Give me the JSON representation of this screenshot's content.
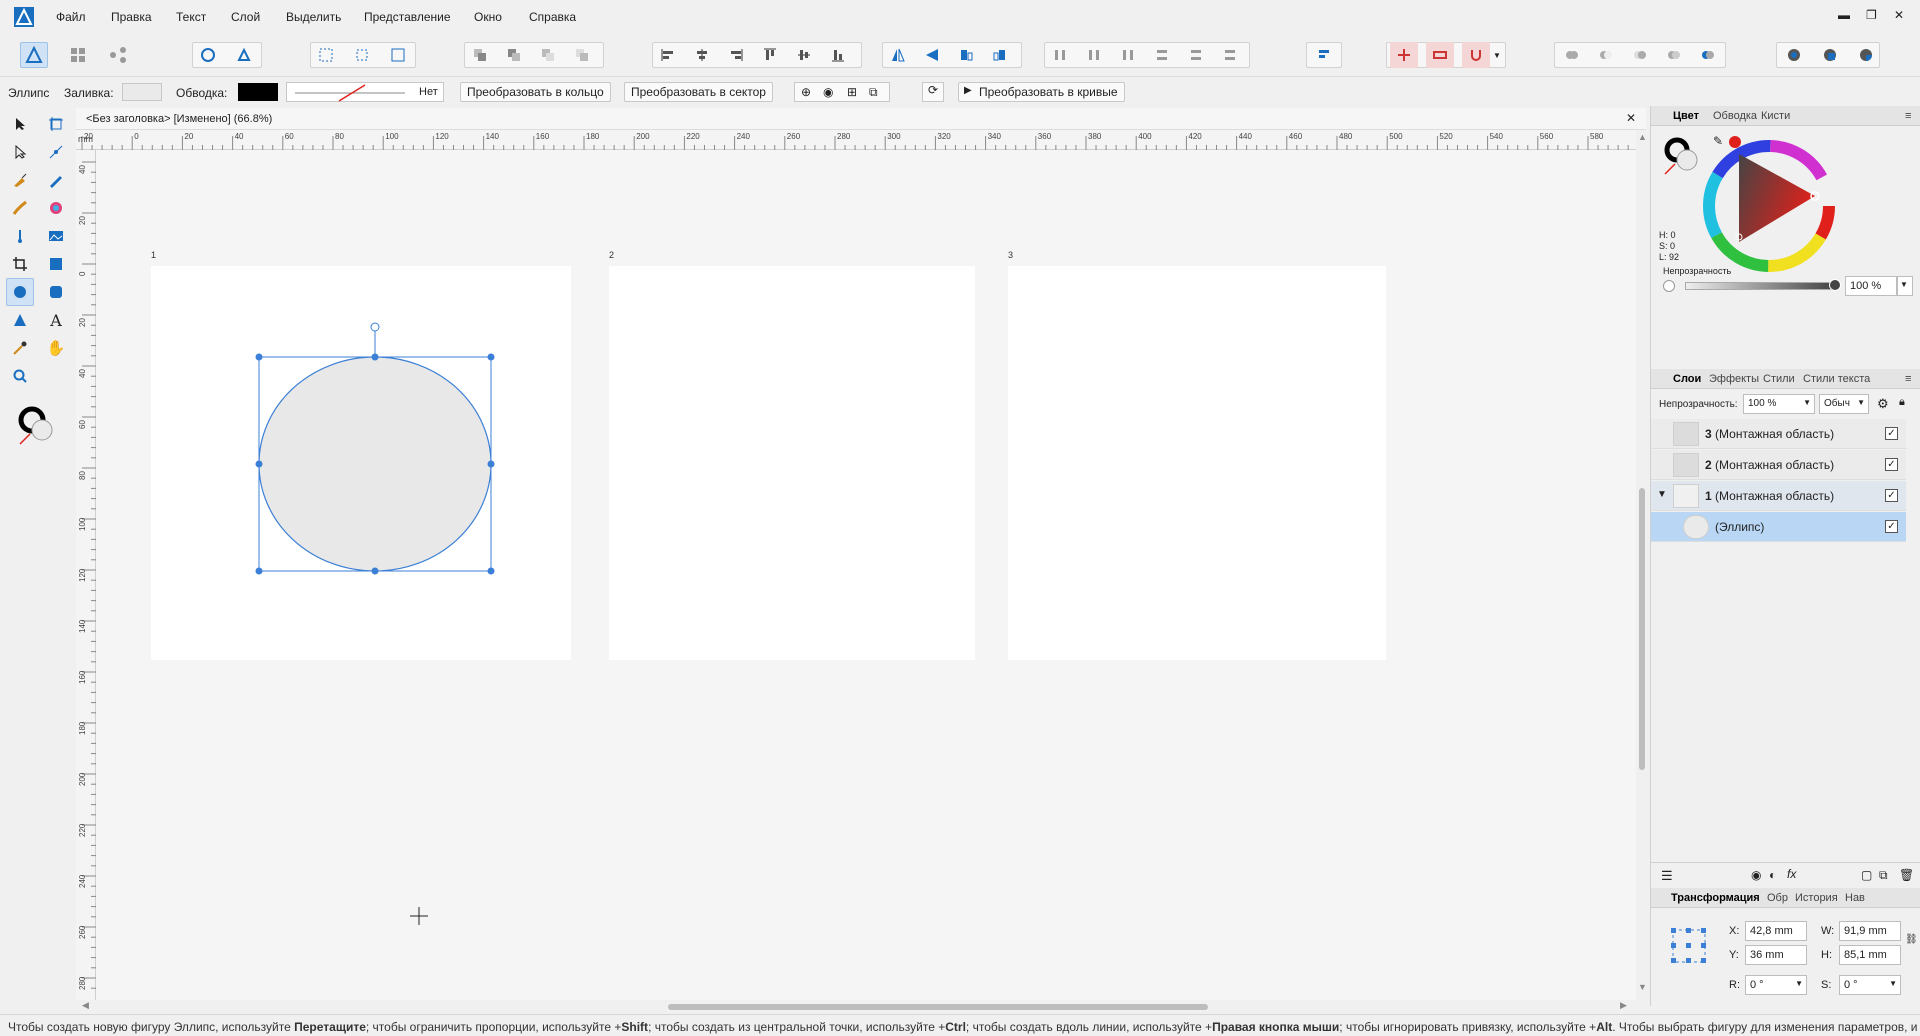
{
  "menu": {
    "items": [
      "Файл",
      "Правка",
      "Текст",
      "Слой",
      "Выделить",
      "Представление",
      "Окно",
      "Справка"
    ]
  },
  "context_bar": {
    "shape_name": "Эллипс",
    "fill_label": "Заливка:",
    "stroke_label": "Обводка:",
    "stroke_style": "Нет",
    "convert_ring": "Преобразовать в кольцо",
    "convert_sector": "Преобразовать в сектор",
    "convert_curves": "Преобразовать в кривые"
  },
  "document": {
    "tab_title": "<Без заголовка> [Изменено] (66.8%)",
    "ruler_unit": "mm",
    "ruler_h_ticks": [
      "20",
      "0",
      "20",
      "40",
      "60",
      "80",
      "100",
      "120",
      "140",
      "160",
      "180",
      "200",
      "220",
      "240",
      "260",
      "280",
      "300",
      "320",
      "340",
      "360",
      "380",
      "400",
      "420",
      "440",
      "460",
      "480",
      "500",
      "520",
      "540",
      "560",
      "580",
      "600"
    ],
    "ruler_v_ticks": [
      "40",
      "20",
      "0",
      "20",
      "40",
      "60",
      "80",
      "100",
      "120",
      "140",
      "160",
      "180",
      "200",
      "220",
      "240",
      "260",
      "280"
    ],
    "artboards": [
      {
        "label": "1"
      },
      {
        "label": "2"
      },
      {
        "label": "3"
      }
    ]
  },
  "color_panel": {
    "tabs": [
      "Цвет",
      "Обводка",
      "Кисти"
    ],
    "h": "H: 0",
    "s": "S: 0",
    "l": "L: 92",
    "opacity_label": "Непрозрачность",
    "opacity_value": "100 %",
    "accent": "#e0211b"
  },
  "layers_panel": {
    "tabs": [
      "Слои",
      "Эффекты",
      "Стили",
      "Стили текста"
    ],
    "opacity_label": "Непрозрачность:",
    "opacity_value": "100 %",
    "blend_mode": "Обыч",
    "rows": [
      {
        "num": "3",
        "label": "(Монтажная область)"
      },
      {
        "num": "2",
        "label": "(Монтажная область)"
      },
      {
        "num": "1",
        "label": "(Монтажная область)"
      },
      {
        "num": "",
        "label": "(Эллипс)"
      }
    ]
  },
  "transform_panel": {
    "tabs": [
      "Трансформация",
      "Обр",
      "История",
      "Нав"
    ],
    "x_label": "X:",
    "x_value": "42,8 mm",
    "y_label": "Y:",
    "y_value": "36 mm",
    "w_label": "W:",
    "w_value": "91,9 mm",
    "h_label": "H:",
    "h_value": "85,1 mm",
    "r_label": "R:",
    "r_value": "0 °",
    "s_label": "S:",
    "s_value": "0 °"
  },
  "status": {
    "parts": [
      {
        "text": "Чтобы создать новую фигуру Эллипс, используйте ",
        "bold": false
      },
      {
        "text": "Перетащите",
        "bold": true
      },
      {
        "text": "; чтобы ограничить пропорции, используйте +",
        "bold": false
      },
      {
        "text": "Shift",
        "bold": true
      },
      {
        "text": "; чтобы создать из центральной точки, используйте +",
        "bold": false
      },
      {
        "text": "Ctrl",
        "bold": true
      },
      {
        "text": "; чтобы создать вдоль линии, используйте +",
        "bold": false
      },
      {
        "text": "Правая кнопка мыши",
        "bold": true
      },
      {
        "text": "; чтобы игнорировать привязку, используйте +",
        "bold": false
      },
      {
        "text": "Alt",
        "bold": true
      },
      {
        "text": ". Чтобы выбрать фигуру для изменения параметров, и",
        "bold": false
      }
    ]
  }
}
